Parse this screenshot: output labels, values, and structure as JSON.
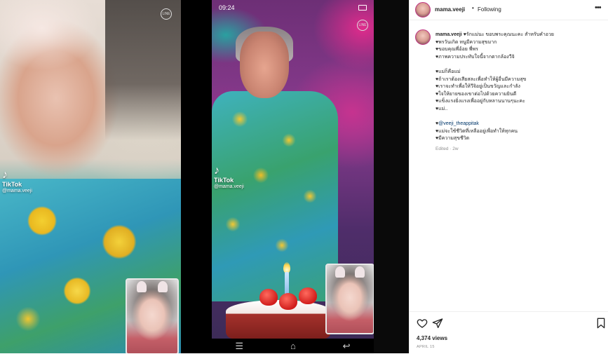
{
  "status_bar": {
    "time": "09:24"
  },
  "tiktok": {
    "logo_glyph": "♪",
    "brand": "TikTok",
    "handle": "@mama.veeji"
  },
  "line_badge": "LINE",
  "nav_buttons": [
    "☰",
    "⌂",
    "↩"
  ],
  "post": {
    "username": "mama.veeji",
    "separator": "•",
    "follow_status": "Following",
    "more_icon": "more-horizontal-icon",
    "caption_lines": [
      "♥รักแม่นะ ขอบพระคุณนะคะ สำหรับคำอวย",
      "♥พรวันเกิด หนูมีความสุขมาก",
      "♥ขอบคุณพี่อ้อย พี่พร",
      "♥ภาพความประทับใจนี้จากตากล้องวีจิ",
      "",
      "♥แม่ก็คือแม่",
      "♥ถ้าเราต้องเสียสละเพื่อทำให้ผู้อื่นมีความสุข",
      "♥เราจะทำเพื่อให้วีจิอยู่เป็นขวัญและกำลัง",
      "♥ใจให้ยายของเขาต่อไปด้วยความยินดี",
      "♥แข็งแรงยิ่งแรงเพื่ออยู่กับหลานนานๆนะคะ",
      "♥แม่..",
      "",
      "♥@veeji_theappitak",
      "♥แม่จะใช้ชีวิตที่เหลืออยู่เพื่อทำให้ทุกคน",
      "♥มีความสุขชีวิต"
    ],
    "edited": "Edited · 2w",
    "views": "4,374 views",
    "date": "APRIL 15"
  },
  "icons": {
    "like": "heart-icon",
    "share": "send-icon",
    "save": "bookmark-icon"
  }
}
